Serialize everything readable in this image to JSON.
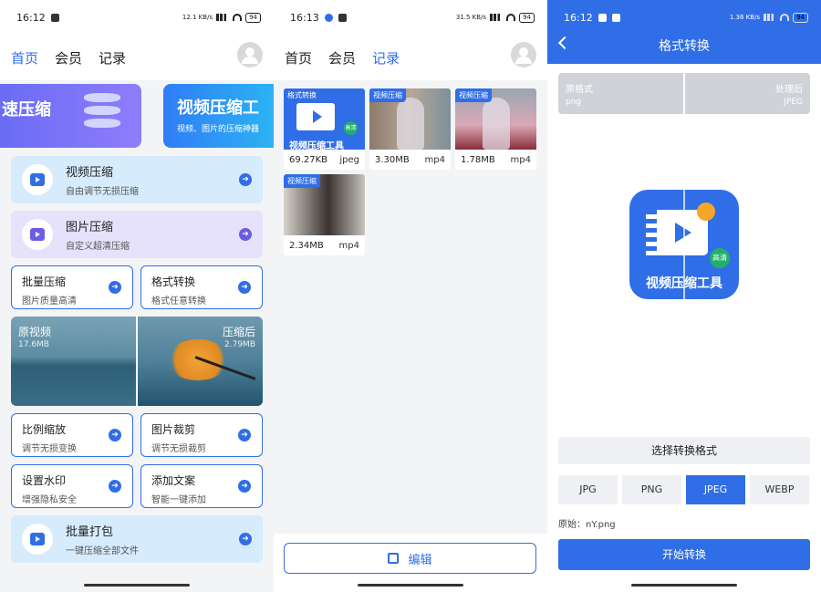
{
  "phone1": {
    "status": {
      "time": "16:12",
      "net": "12.1 KB/s",
      "battery": "94"
    },
    "nav": {
      "tabs": [
        {
          "label": "首页",
          "active": true
        },
        {
          "label": "会员"
        },
        {
          "label": "记录"
        }
      ]
    },
    "banners": [
      {
        "title": "速压缩"
      },
      {
        "title": "视频压缩工",
        "subtitle": "视频、图片的压缩神器"
      }
    ],
    "wide_cards": [
      {
        "title": "视频压缩",
        "subtitle": "自由调节无损压缩",
        "icon": "video-icon"
      },
      {
        "title": "图片压缩",
        "subtitle": "自定义超清压缩",
        "icon": "image-icon"
      },
      {
        "title": "批量打包",
        "subtitle": "一键压缩全部文件",
        "icon": "package-icon"
      }
    ],
    "half_cards": [
      {
        "title": "批量压缩",
        "subtitle": "图片质量高清"
      },
      {
        "title": "格式转换",
        "subtitle": "格式任意转换"
      },
      {
        "title": "比例缩放",
        "subtitle": "调节无损变换"
      },
      {
        "title": "图片裁剪",
        "subtitle": "调节无损裁剪"
      },
      {
        "title": "设置水印",
        "subtitle": "增强隐私安全"
      },
      {
        "title": "添加文案",
        "subtitle": "智能一键添加"
      }
    ],
    "compare": {
      "left_label": "原视频",
      "left_size": "17.6MB",
      "right_label": "压缩后",
      "right_size": "2.79MB"
    }
  },
  "phone2": {
    "status": {
      "time": "16:13",
      "net": "31.5 KB/s",
      "battery": "94"
    },
    "nav": {
      "tabs": [
        {
          "label": "首页"
        },
        {
          "label": "会员"
        },
        {
          "label": "记录",
          "active": true
        }
      ]
    },
    "records": [
      {
        "tag": "格式转换",
        "size": "69.27KB",
        "ext": "jpeg",
        "caption": "视频压缩工具",
        "hd": "高清"
      },
      {
        "tag": "视频压缩",
        "size": "3.30MB",
        "ext": "mp4"
      },
      {
        "tag": "视频压缩",
        "size": "1.78MB",
        "ext": "mp4"
      },
      {
        "tag": "视频压缩",
        "size": "2.34MB",
        "ext": "mp4"
      }
    ],
    "edit_label": "编辑"
  },
  "phone3": {
    "status": {
      "time": "16:12",
      "net": "1.36 KB/s",
      "battery": "94"
    },
    "title": "格式转换",
    "format_bar": {
      "orig_label": "原格式",
      "orig_value": "png",
      "after_label": "处理后",
      "after_value": "JPEG"
    },
    "icon_caption": "视频压缩工具",
    "icon_hd": "高清",
    "choose_label": "选择转换格式",
    "formats": [
      "JPG",
      "PNG",
      "JPEG",
      "WEBP"
    ],
    "selected_format": "JPEG",
    "original_file": "原始：nY.png",
    "start_label": "开始转换"
  },
  "colors": {
    "accent": "#2f6ee6",
    "purple": "#6b5ce7",
    "light_blue": "#d6ebfb",
    "light_purple": "#e6e2fb"
  }
}
